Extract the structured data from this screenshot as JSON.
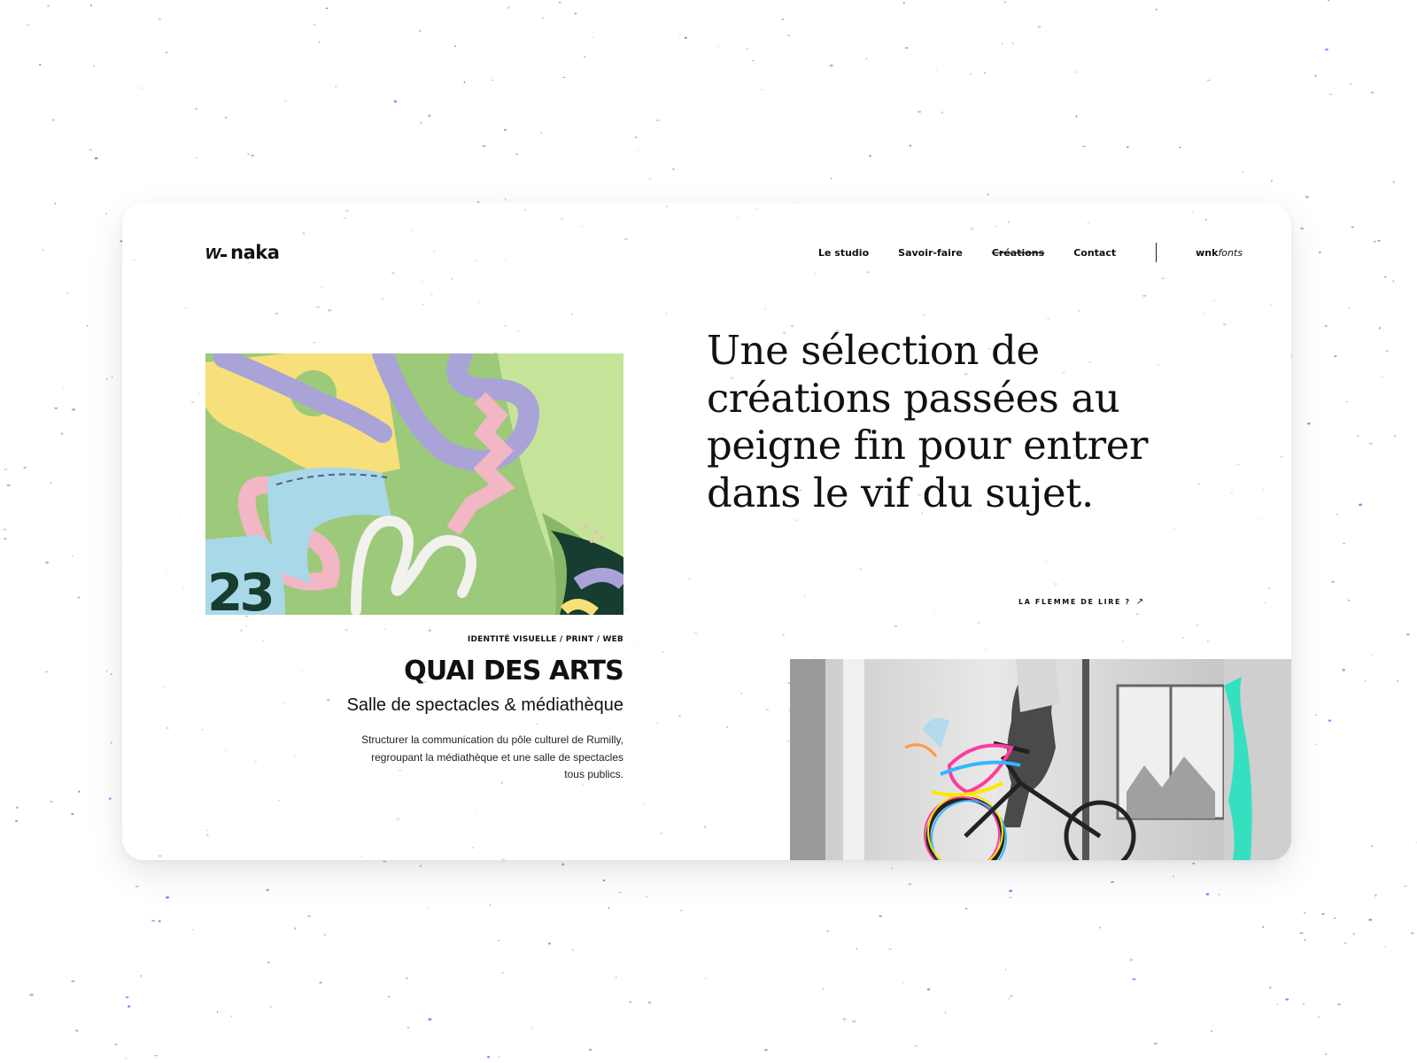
{
  "brand": {
    "logo_mark": "w",
    "logo_text": "naka"
  },
  "nav": {
    "items": [
      {
        "label": "Le studio",
        "active": false
      },
      {
        "label": "Savoir-faire",
        "active": false
      },
      {
        "label": "Créations",
        "active": true
      },
      {
        "label": "Contact",
        "active": false
      }
    ],
    "fonts_link": {
      "bold": "wnk",
      "italic": "fonts"
    }
  },
  "project": {
    "categories": "IDENTITÉ VISUELLE / PRINT / WEB",
    "title": "QUAI DES ARTS",
    "subtitle": "Salle de spectacles & médiathèque",
    "description": "Structurer la communication du pôle culturel de Rumilly, regroupant la médiathèque et une salle de spectacles tous publics.",
    "artwork_number": "23"
  },
  "headline": "Une sélection de créations passées au peigne fin pour entrer dans le vif du sujet.",
  "lazy_link": {
    "label": "LA FLEMME DE LIRE ?",
    "arrow": "↗"
  },
  "colors": {
    "artwork_green": "#9dc97a",
    "artwork_yellow": "#f7e07a",
    "artwork_purple": "#a9a3d8",
    "artwork_pink": "#f2b6c4",
    "artwork_blue": "#a9d8e8",
    "artwork_dark": "#173c30",
    "bike_accent": "#35e0c0"
  }
}
